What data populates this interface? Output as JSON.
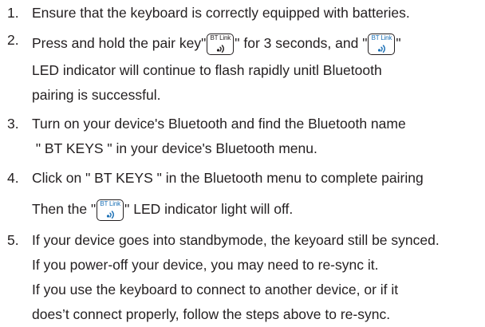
{
  "steps": [
    {
      "number": "1.",
      "line1": "Ensure that the keyboard is correctly equipped with batteries."
    },
    {
      "number": "2.",
      "line1_a": "Press and hold the pair key\"",
      "key_label": "BT Link",
      "line1_b": "\" for 3 seconds, and \"",
      "line1_c": "\"",
      "line2": "LED indicator will continue to flash rapidly unitl Bluetooth",
      "line3": "pairing is successful."
    },
    {
      "number": "3.",
      "line1": "Turn on your device's Bluetooth and find the Bluetooth name",
      "line2": " \" BT KEYS \" in your device's Bluetooth menu."
    },
    {
      "number": "4.",
      "line1": "Click on \" BT KEYS \" in the Bluetooth menu to complete pairing",
      "line2_a": "Then the \"",
      "line2_b": "\" LED indicator light will off."
    },
    {
      "number": "5.",
      "line1": "If your device goes into standbymode, the keyoard still be synced.",
      "line2": "If you power-off your device, you may need to re-sync it.",
      "line3": "If you use the keyboard to connect to another device, or if it",
      "line4": "does’t connect properly, follow the steps above to re-sync."
    }
  ]
}
